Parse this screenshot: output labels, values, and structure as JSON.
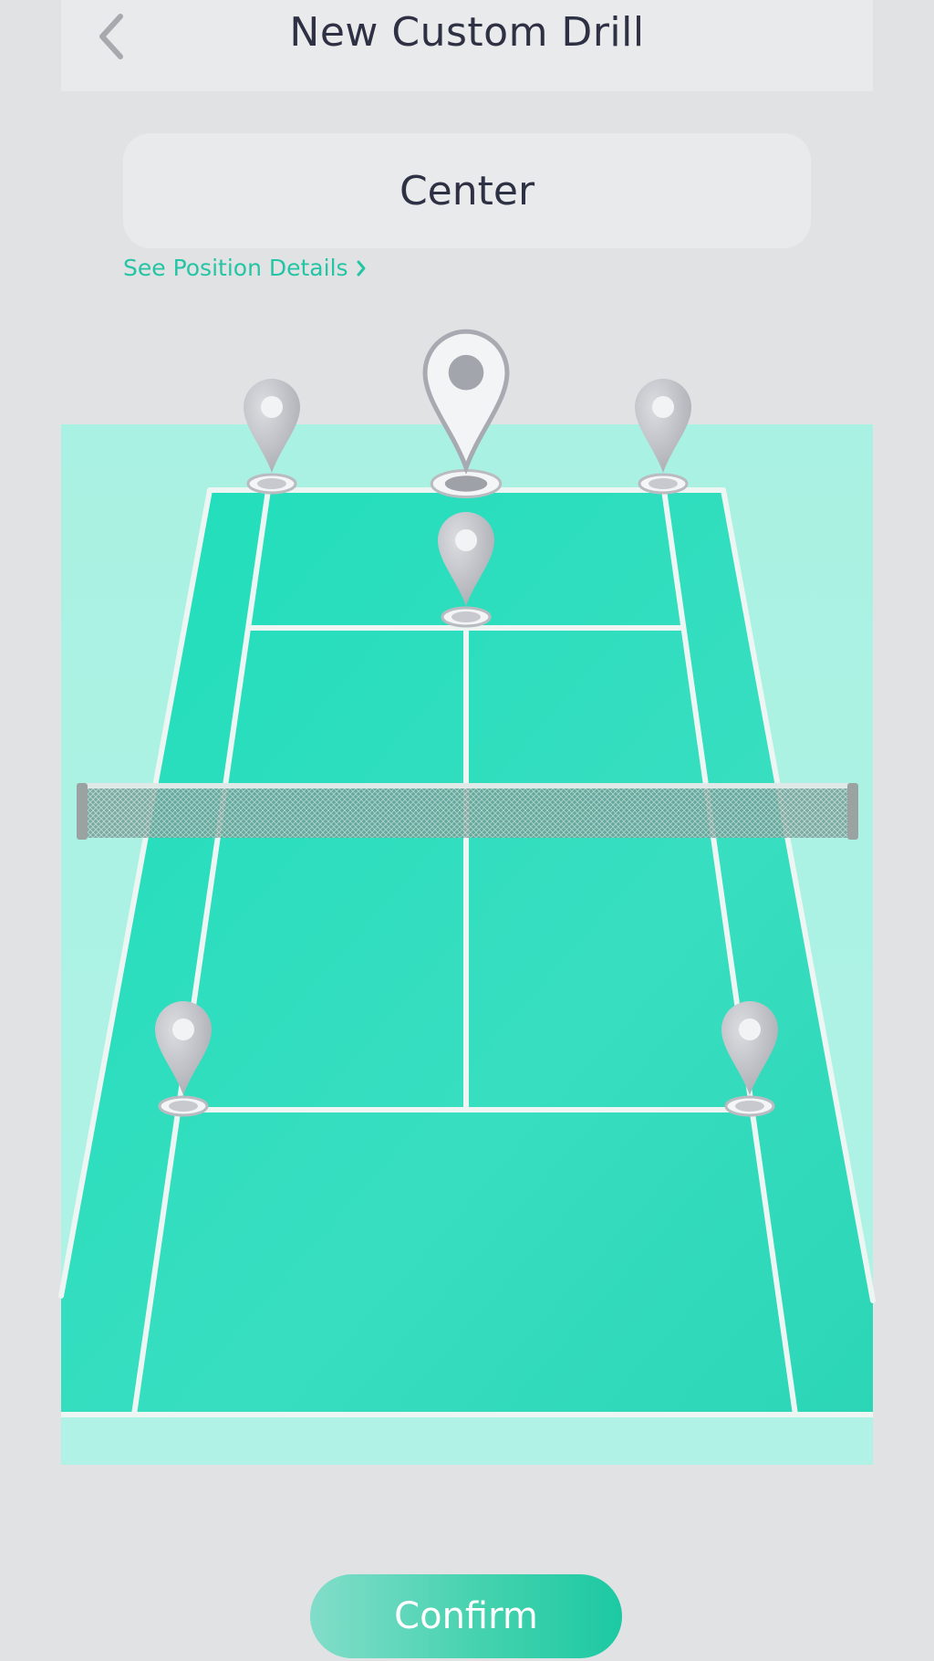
{
  "header": {
    "title": "New Custom Drill",
    "back_icon": "chevron-left-icon"
  },
  "position": {
    "value": "Center"
  },
  "details_link": {
    "label": "See Position Details",
    "icon": "chevron-right-icon"
  },
  "court": {
    "markers": [
      {
        "name": "baseline-left",
        "selected": false
      },
      {
        "name": "baseline-center",
        "selected": true
      },
      {
        "name": "baseline-right",
        "selected": false
      },
      {
        "name": "service-line-center",
        "selected": false
      },
      {
        "name": "near-service-left",
        "selected": false
      },
      {
        "name": "near-service-right",
        "selected": false
      }
    ]
  },
  "footer": {
    "confirm_label": "Confirm"
  },
  "colors": {
    "accent": "#1fcfa8",
    "court": "#22dcb8",
    "court_surround": "#aaf2e3",
    "text": "#2d3143",
    "marker": "#c4c6cb"
  }
}
